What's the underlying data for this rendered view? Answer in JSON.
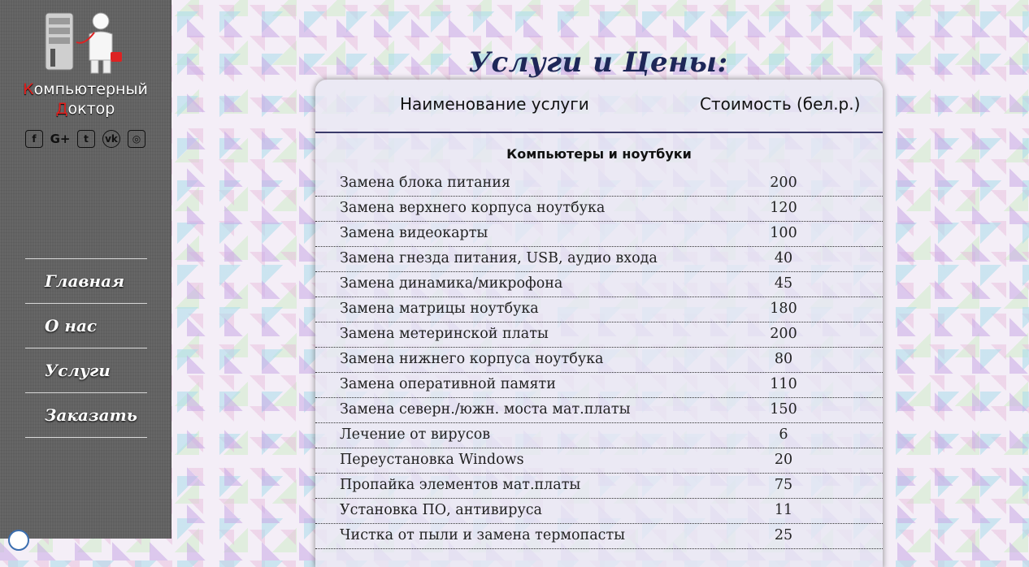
{
  "sidebar": {
    "logo": {
      "line1_first": "К",
      "line1_rest": "омпьютерный",
      "line2_first": "Д",
      "line2_rest": "октор"
    },
    "socials": [
      {
        "icon": "facebook-icon",
        "glyph": "f"
      },
      {
        "icon": "google-plus-icon",
        "glyph": "G+"
      },
      {
        "icon": "twitter-icon",
        "glyph": "t"
      },
      {
        "icon": "vk-icon",
        "glyph": "vk"
      },
      {
        "icon": "instagram-icon",
        "glyph": "◎"
      }
    ],
    "nav": [
      {
        "label": "Главная"
      },
      {
        "label": "О нас"
      },
      {
        "label": "Услуги"
      },
      {
        "label": "Заказать"
      }
    ]
  },
  "main": {
    "title": "Услуги и Цены:",
    "table": {
      "header_name": "Наименование услуги",
      "header_price": "Стоимость (бел.р.)",
      "section": "Компьютеры и ноутбуки",
      "rows": [
        {
          "name": "Замена блока питания",
          "price": "200"
        },
        {
          "name": "Замена верхнего корпуса ноутбука",
          "price": "120"
        },
        {
          "name": "Замена видеокарты",
          "price": "100"
        },
        {
          "name": "Замена гнезда питания, USB, аудио входа",
          "price": "40"
        },
        {
          "name": "Замена динамика/микрофона",
          "price": "45"
        },
        {
          "name": "Замена матрицы ноутбука",
          "price": "180"
        },
        {
          "name": "Замена метеринской платы",
          "price": "200"
        },
        {
          "name": "Замена нижнего корпуса ноутбука",
          "price": "80"
        },
        {
          "name": "Замена оперативной памяти",
          "price": "110"
        },
        {
          "name": "Замена северн./южн. моста мат.платы",
          "price": "150"
        },
        {
          "name": "Лечение от вирусов",
          "price": "6"
        },
        {
          "name": "Переустановка Windows",
          "price": "20"
        },
        {
          "name": "Пропайка элементов мат.платы",
          "price": "75"
        },
        {
          "name": "Установка ПО, антивируса",
          "price": "11"
        },
        {
          "name": "Чистка от пыли и замена термопасты",
          "price": "25"
        }
      ]
    }
  },
  "colors": {
    "sidebar_bg": "#626262",
    "title": "#1e2758",
    "logo_accent": "#e0201e"
  }
}
